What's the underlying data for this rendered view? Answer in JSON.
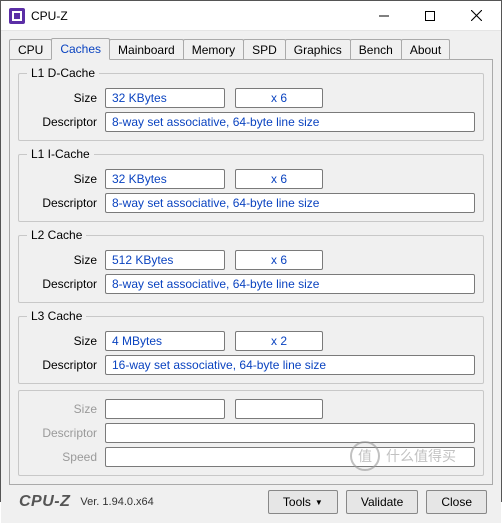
{
  "window": {
    "title": "CPU-Z"
  },
  "tabs": [
    "CPU",
    "Caches",
    "Mainboard",
    "Memory",
    "SPD",
    "Graphics",
    "Bench",
    "About"
  ],
  "active_tab": 1,
  "caches": [
    {
      "legend": "L1 D-Cache",
      "size": "32 KBytes",
      "mul": "x 6",
      "descriptor": "8-way set associative, 64-byte line size",
      "disabled": false
    },
    {
      "legend": "L1 I-Cache",
      "size": "32 KBytes",
      "mul": "x 6",
      "descriptor": "8-way set associative, 64-byte line size",
      "disabled": false
    },
    {
      "legend": "L2 Cache",
      "size": "512 KBytes",
      "mul": "x 6",
      "descriptor": "8-way set associative, 64-byte line size",
      "disabled": false
    },
    {
      "legend": "L3 Cache",
      "size": "4 MBytes",
      "mul": "x 2",
      "descriptor": "16-way set associative, 64-byte line size",
      "disabled": false
    },
    {
      "legend": "",
      "size": "",
      "mul": "",
      "descriptor": "",
      "speed": "",
      "disabled": true
    }
  ],
  "labels": {
    "size": "Size",
    "descriptor": "Descriptor",
    "speed": "Speed"
  },
  "footer": {
    "brand": "CPU-Z",
    "version": "Ver. 1.94.0.x64",
    "tools": "Tools",
    "validate": "Validate",
    "close": "Close"
  },
  "watermark": "什么值得买"
}
